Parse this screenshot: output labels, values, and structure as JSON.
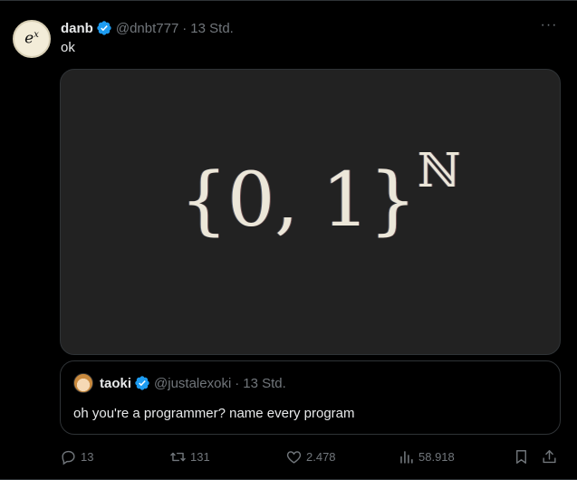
{
  "tweet": {
    "avatar_text": "e",
    "avatar_sup": "x",
    "name": "danb",
    "handle": "@dnbt777",
    "separator": "·",
    "time": "13 Std.",
    "text": "ok",
    "more_label": "···",
    "image": {
      "formula": "{0, 1}",
      "exponent": "ℕ"
    }
  },
  "quote": {
    "name": "taoki",
    "handle": "@justalexoki",
    "separator": "·",
    "time": "13 Std.",
    "text": "oh you're a programmer? name every program"
  },
  "actions": {
    "replies": "13",
    "reposts": "131",
    "likes": "2.478",
    "views": "58.918"
  },
  "colors": {
    "background": "#000000",
    "text": "#e7e9ea",
    "muted": "#71767b",
    "verified": "#1d9bf0",
    "border": "#2f3336",
    "media_bg": "#222222"
  },
  "icons": [
    "verified-badge-icon",
    "more-icon",
    "reply-icon",
    "repost-icon",
    "like-icon",
    "views-icon",
    "bookmark-icon",
    "share-icon"
  ]
}
